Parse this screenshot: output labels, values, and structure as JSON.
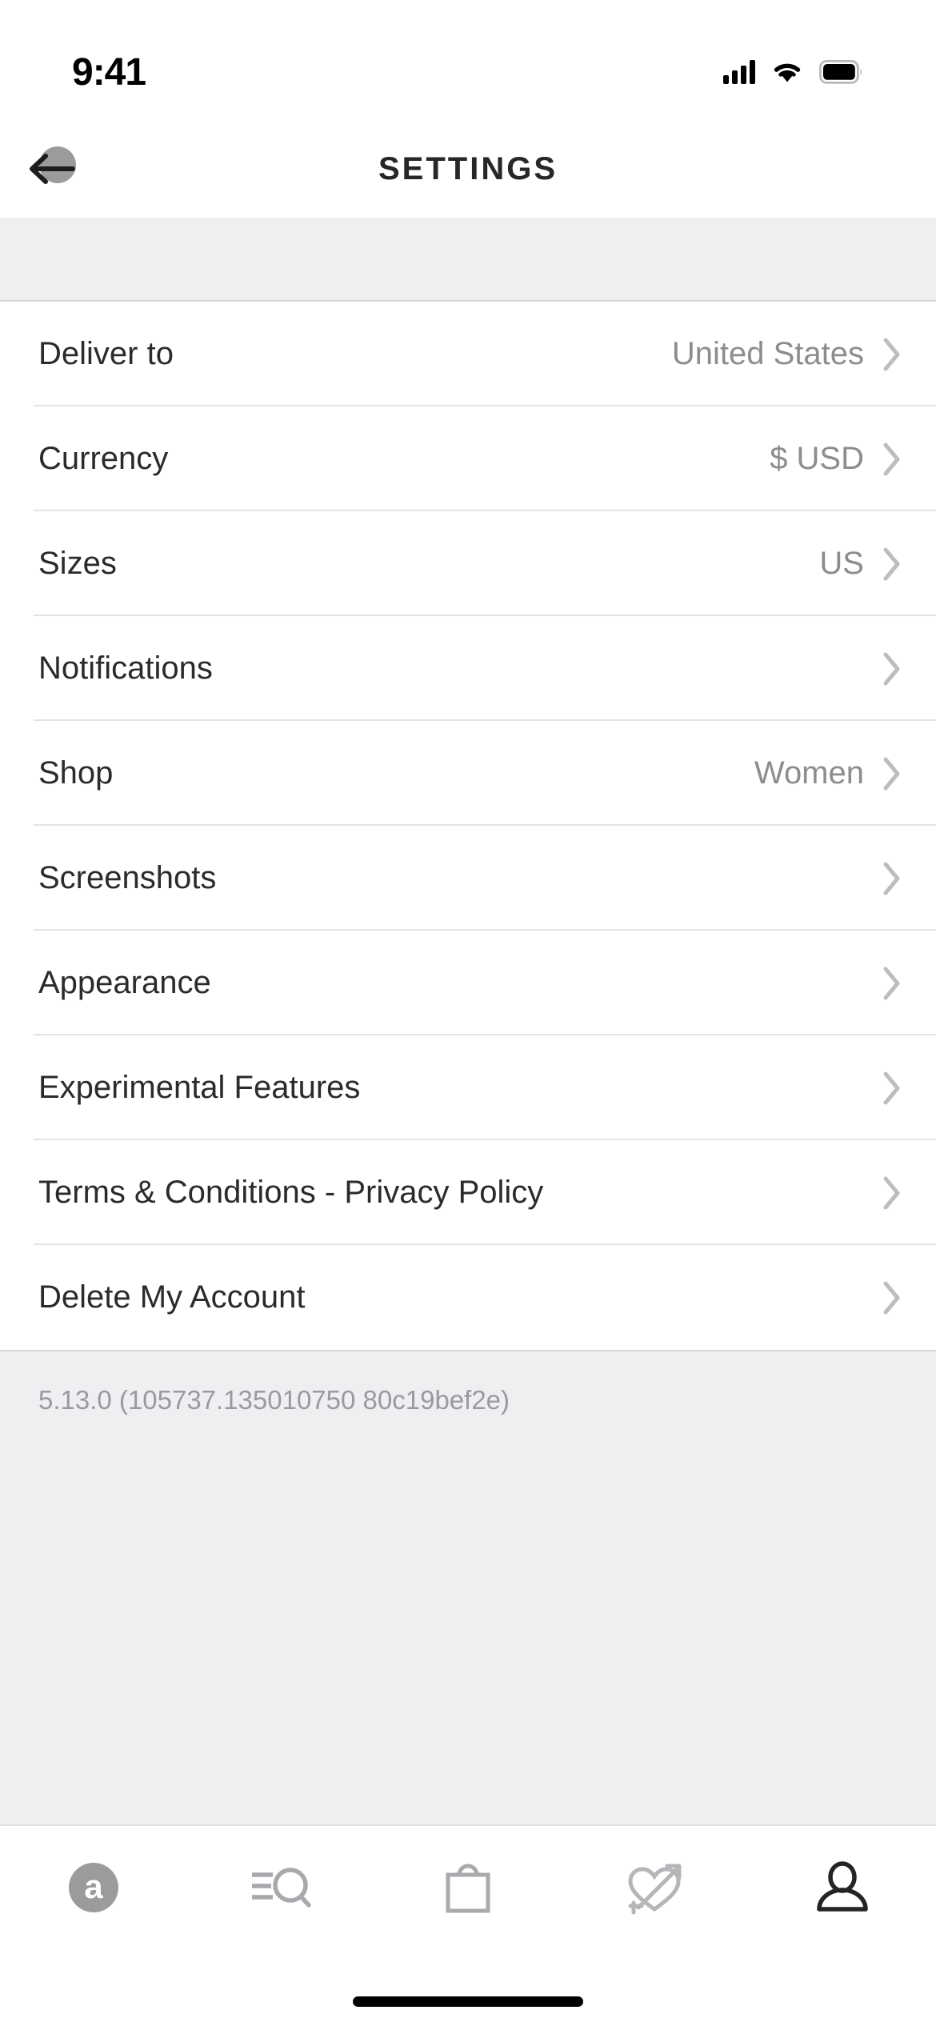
{
  "status_bar": {
    "time": "9:41",
    "signal_icon": "cellular-signal-icon",
    "wifi_icon": "wifi-icon",
    "battery_icon": "battery-full-icon"
  },
  "navbar": {
    "title": "SETTINGS",
    "back_icon": "back-arrow-icon"
  },
  "settings": {
    "rows": [
      {
        "label": "Deliver to",
        "value": "United States"
      },
      {
        "label": "Currency",
        "value": "$ USD"
      },
      {
        "label": "Sizes",
        "value": "US"
      },
      {
        "label": "Notifications",
        "value": ""
      },
      {
        "label": "Shop",
        "value": "Women"
      },
      {
        "label": "Screenshots",
        "value": ""
      },
      {
        "label": "Appearance",
        "value": ""
      },
      {
        "label": "Experimental Features",
        "value": ""
      },
      {
        "label": "Terms & Conditions - Privacy Policy",
        "value": ""
      },
      {
        "label": "Delete My Account",
        "value": ""
      }
    ],
    "chevron_icon": "chevron-right-icon"
  },
  "footer": {
    "version": "5.13.0 (105737.135010750 80c19bef2e)"
  },
  "tabbar": {
    "items": [
      {
        "name": "home",
        "icon": "brand-a-icon",
        "letter": "a",
        "active": false
      },
      {
        "name": "search",
        "icon": "search-list-icon",
        "active": false
      },
      {
        "name": "bag",
        "icon": "shopping-bag-icon",
        "active": false
      },
      {
        "name": "wishlist",
        "icon": "heart-arrow-icon",
        "active": false
      },
      {
        "name": "account",
        "icon": "person-icon",
        "active": true
      }
    ]
  },
  "colors": {
    "page_bg": "#ffffff",
    "band_bg": "#efeef1",
    "label": "#2b2b2b",
    "value": "#8d8d91",
    "separator": "#e3e3e5",
    "icon_inactive": "#a9a9ad",
    "icon_active": "#242424",
    "badge": "#9b9b9b"
  }
}
